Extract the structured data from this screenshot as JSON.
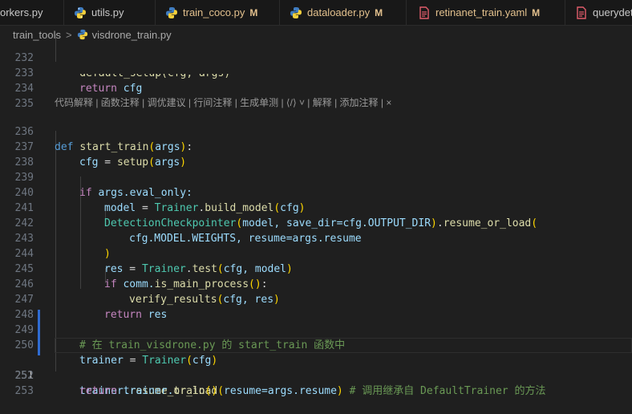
{
  "tabs": [
    {
      "label": "orkers.py",
      "icon": "python-icon",
      "modified": false
    },
    {
      "label": "utils.py",
      "icon": "python-icon",
      "modified": false
    },
    {
      "label": "train_coco.py",
      "icon": "python-icon",
      "modified": true,
      "badge": "M"
    },
    {
      "label": "dataloader.py",
      "icon": "python-icon",
      "modified": true,
      "badge": "M"
    },
    {
      "label": "retinanet_train.yaml",
      "icon": "yaml-icon",
      "modified": true,
      "badge": "M"
    },
    {
      "label": "querydet_",
      "icon": "yaml-icon",
      "modified": false
    }
  ],
  "breadcrumb": {
    "folder": "train_tools",
    "separator": ">",
    "file": "visdrone_train.py"
  },
  "codelens": "代码解释 | 函数注释 | 调优建议 | 行间注释 | 生成单测 | ⟨/⟩ ˅ | 解释 | 添加注释 | ×",
  "lines": {
    "n232": "232",
    "n233": "233",
    "n234": "234",
    "n235": "235",
    "n236": "236",
    "n237": "237",
    "n238": "238",
    "n239": "239",
    "n240": "240",
    "n241": "241",
    "n242": "242",
    "n243": "243",
    "n244": "244",
    "n245": "245",
    "n246": "246",
    "n247": "247",
    "n248": "248",
    "n249": "249",
    "n250": "250",
    "n251": "251",
    "n252": "252",
    "n253": "253"
  },
  "code": {
    "l232": "    default_setup(cfg, args)",
    "l233_kw": "return",
    "l233_rest": " cfg",
    "l236_def": "def",
    "l236_fn": "start_train",
    "l236_p": "args",
    "l237_a": "cfg",
    "l237_b": " = ",
    "l237_fn": "setup",
    "l237_p": "args",
    "l239_if": "if",
    "l239_rest": "args.eval_only:",
    "l240_a": "model",
    "l240_b": " = ",
    "l240_cls": "Trainer",
    "l240_c": ".",
    "l240_fn": "build_model",
    "l240_p": "cfg",
    "l241_cls": "DetectionCheckpointer",
    "l241_a": "model, ",
    "l241_k": "save_dir",
    "l241_b": "=cfg.OUTPUT_DIR",
    "l241_c": ".",
    "l241_fn": "resume_or_load",
    "l242_a": "cfg.MODEL.WEIGHTS, ",
    "l242_k": "resume",
    "l242_b": "=args.resume",
    "l243": ")",
    "l244_a": "res",
    "l244_b": " = ",
    "l244_cls": "Trainer",
    "l244_c": ".",
    "l244_fn": "test",
    "l244_p": "cfg, model",
    "l245_if": "if",
    "l245_a": " comm.",
    "l245_fn": "is_main_process",
    "l245_b": ":",
    "l246_fn": "verify_results",
    "l246_p": "cfg, res",
    "l247_kw": "return",
    "l247_rest": " res",
    "l249_cm": "# 在 train_visdrone.py 的 start_train 函数中",
    "l250_a": "trainer",
    "l250_b": " = ",
    "l250_cls": "Trainer",
    "l250_p": "cfg",
    "l251_a": "trainer.",
    "l251_fn": "resume_or_load",
    "l251_k": "resume",
    "l251_b": "=args.resume",
    "l251_cm": " # 调用继承自 DefaultTrainer 的方法",
    "l252_kw": "return",
    "l252_a": " trainer.",
    "l252_fn": "train"
  },
  "colors": {
    "background": "#1f1f1f",
    "keyword": "#569cd6",
    "control": "#c586c0",
    "function": "#dcdcaa",
    "class": "#4ec9b0",
    "variable": "#9cdcfe",
    "comment": "#6a9955",
    "modified": "#e2c08d",
    "git_modified_bar": "#2f6bd1"
  }
}
